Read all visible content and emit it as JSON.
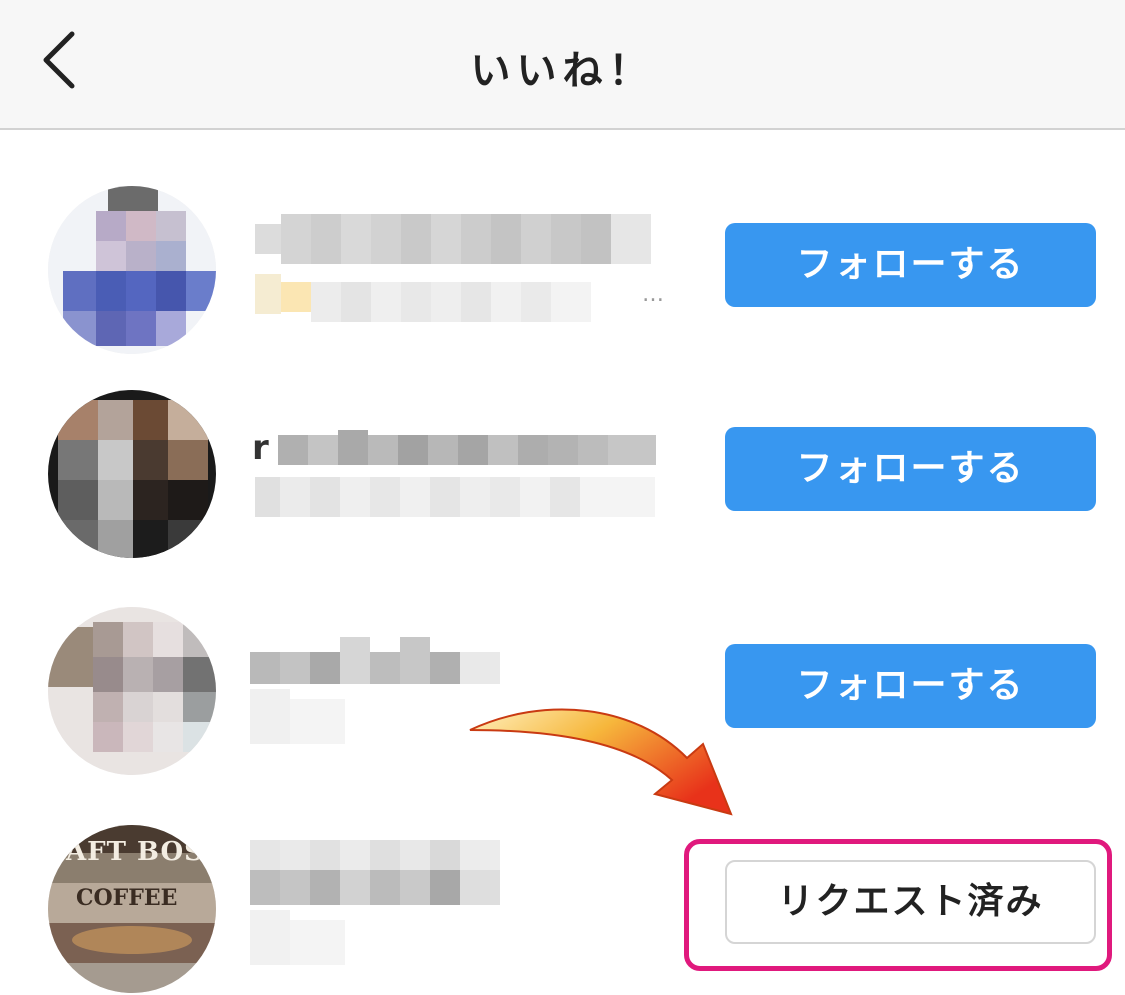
{
  "header": {
    "title": "いいね！",
    "back_icon": "chevron-left-icon"
  },
  "users": [
    {
      "button_label": "フォローする",
      "name_prefix": "",
      "bio_prefix": "",
      "overflow": "…"
    },
    {
      "button_label": "フォローする",
      "name_prefix": "r",
      "bio_prefix": ""
    },
    {
      "button_label": "フォローする"
    },
    {
      "button_label": "リクエスト済み",
      "avatar_text": "AFT BOS",
      "avatar_sub": "COFFEE"
    }
  ],
  "colors": {
    "follow_button": "#3897f0",
    "highlight_border": "#e0197d",
    "arrow_start": "#ffe28a",
    "arrow_end": "#e8321a"
  }
}
